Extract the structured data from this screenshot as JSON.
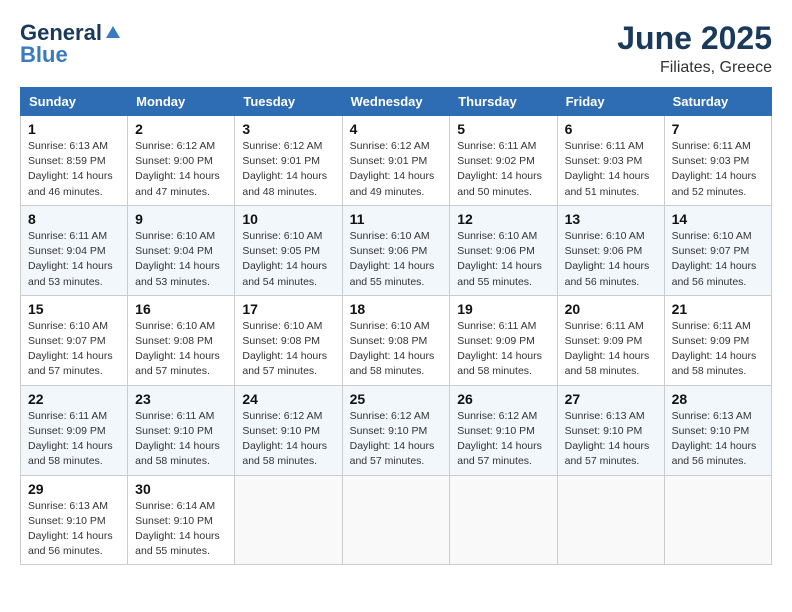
{
  "header": {
    "logo_general": "General",
    "logo_blue": "Blue",
    "title": "June 2025",
    "subtitle": "Filiates, Greece"
  },
  "days_of_week": [
    "Sunday",
    "Monday",
    "Tuesday",
    "Wednesday",
    "Thursday",
    "Friday",
    "Saturday"
  ],
  "weeks": [
    [
      {
        "day": 1,
        "sunrise": "6:13 AM",
        "sunset": "8:59 PM",
        "daylight": "14 hours and 46 minutes."
      },
      {
        "day": 2,
        "sunrise": "6:12 AM",
        "sunset": "9:00 PM",
        "daylight": "14 hours and 47 minutes."
      },
      {
        "day": 3,
        "sunrise": "6:12 AM",
        "sunset": "9:01 PM",
        "daylight": "14 hours and 48 minutes."
      },
      {
        "day": 4,
        "sunrise": "6:12 AM",
        "sunset": "9:01 PM",
        "daylight": "14 hours and 49 minutes."
      },
      {
        "day": 5,
        "sunrise": "6:11 AM",
        "sunset": "9:02 PM",
        "daylight": "14 hours and 50 minutes."
      },
      {
        "day": 6,
        "sunrise": "6:11 AM",
        "sunset": "9:03 PM",
        "daylight": "14 hours and 51 minutes."
      },
      {
        "day": 7,
        "sunrise": "6:11 AM",
        "sunset": "9:03 PM",
        "daylight": "14 hours and 52 minutes."
      }
    ],
    [
      {
        "day": 8,
        "sunrise": "6:11 AM",
        "sunset": "9:04 PM",
        "daylight": "14 hours and 53 minutes."
      },
      {
        "day": 9,
        "sunrise": "6:10 AM",
        "sunset": "9:04 PM",
        "daylight": "14 hours and 53 minutes."
      },
      {
        "day": 10,
        "sunrise": "6:10 AM",
        "sunset": "9:05 PM",
        "daylight": "14 hours and 54 minutes."
      },
      {
        "day": 11,
        "sunrise": "6:10 AM",
        "sunset": "9:06 PM",
        "daylight": "14 hours and 55 minutes."
      },
      {
        "day": 12,
        "sunrise": "6:10 AM",
        "sunset": "9:06 PM",
        "daylight": "14 hours and 55 minutes."
      },
      {
        "day": 13,
        "sunrise": "6:10 AM",
        "sunset": "9:06 PM",
        "daylight": "14 hours and 56 minutes."
      },
      {
        "day": 14,
        "sunrise": "6:10 AM",
        "sunset": "9:07 PM",
        "daylight": "14 hours and 56 minutes."
      }
    ],
    [
      {
        "day": 15,
        "sunrise": "6:10 AM",
        "sunset": "9:07 PM",
        "daylight": "14 hours and 57 minutes."
      },
      {
        "day": 16,
        "sunrise": "6:10 AM",
        "sunset": "9:08 PM",
        "daylight": "14 hours and 57 minutes."
      },
      {
        "day": 17,
        "sunrise": "6:10 AM",
        "sunset": "9:08 PM",
        "daylight": "14 hours and 57 minutes."
      },
      {
        "day": 18,
        "sunrise": "6:10 AM",
        "sunset": "9:08 PM",
        "daylight": "14 hours and 58 minutes."
      },
      {
        "day": 19,
        "sunrise": "6:11 AM",
        "sunset": "9:09 PM",
        "daylight": "14 hours and 58 minutes."
      },
      {
        "day": 20,
        "sunrise": "6:11 AM",
        "sunset": "9:09 PM",
        "daylight": "14 hours and 58 minutes."
      },
      {
        "day": 21,
        "sunrise": "6:11 AM",
        "sunset": "9:09 PM",
        "daylight": "14 hours and 58 minutes."
      }
    ],
    [
      {
        "day": 22,
        "sunrise": "6:11 AM",
        "sunset": "9:09 PM",
        "daylight": "14 hours and 58 minutes."
      },
      {
        "day": 23,
        "sunrise": "6:11 AM",
        "sunset": "9:10 PM",
        "daylight": "14 hours and 58 minutes."
      },
      {
        "day": 24,
        "sunrise": "6:12 AM",
        "sunset": "9:10 PM",
        "daylight": "14 hours and 58 minutes."
      },
      {
        "day": 25,
        "sunrise": "6:12 AM",
        "sunset": "9:10 PM",
        "daylight": "14 hours and 57 minutes."
      },
      {
        "day": 26,
        "sunrise": "6:12 AM",
        "sunset": "9:10 PM",
        "daylight": "14 hours and 57 minutes."
      },
      {
        "day": 27,
        "sunrise": "6:13 AM",
        "sunset": "9:10 PM",
        "daylight": "14 hours and 57 minutes."
      },
      {
        "day": 28,
        "sunrise": "6:13 AM",
        "sunset": "9:10 PM",
        "daylight": "14 hours and 56 minutes."
      }
    ],
    [
      {
        "day": 29,
        "sunrise": "6:13 AM",
        "sunset": "9:10 PM",
        "daylight": "14 hours and 56 minutes."
      },
      {
        "day": 30,
        "sunrise": "6:14 AM",
        "sunset": "9:10 PM",
        "daylight": "14 hours and 55 minutes."
      },
      null,
      null,
      null,
      null,
      null
    ]
  ]
}
